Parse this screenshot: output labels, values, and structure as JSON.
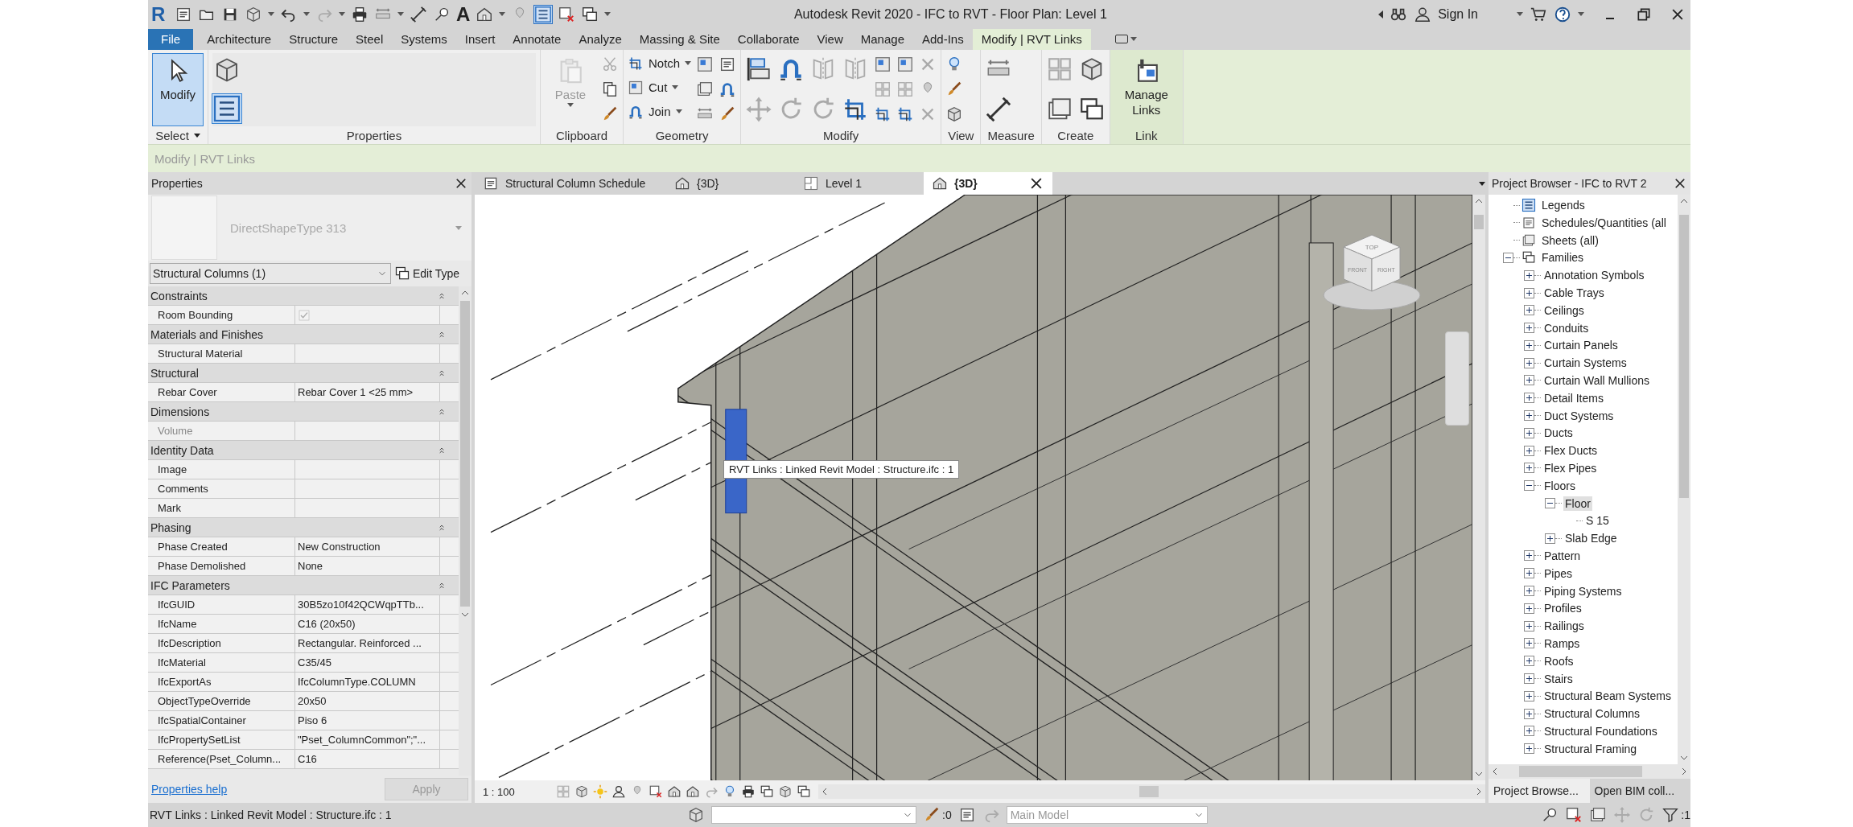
{
  "window": {
    "title": "Autodesk Revit 2020 -  IFC to RVT - Floor Plan: Level 1",
    "app_logo": "R",
    "text_tool": "A"
  },
  "account": {
    "sign_in": "Sign In"
  },
  "ribbon_tabs": [
    {
      "label": "File",
      "kind": "file",
      "selected": false
    },
    {
      "label": "Architecture",
      "kind": "tab",
      "selected": false
    },
    {
      "label": "Structure",
      "kind": "tab",
      "selected": false
    },
    {
      "label": "Steel",
      "kind": "tab",
      "selected": false
    },
    {
      "label": "Systems",
      "kind": "tab",
      "selected": false
    },
    {
      "label": "Insert",
      "kind": "tab",
      "selected": false
    },
    {
      "label": "Annotate",
      "kind": "tab",
      "selected": false
    },
    {
      "label": "Analyze",
      "kind": "tab",
      "selected": false
    },
    {
      "label": "Massing & Site",
      "kind": "tab",
      "selected": false
    },
    {
      "label": "Collaborate",
      "kind": "tab",
      "selected": false
    },
    {
      "label": "View",
      "kind": "tab",
      "selected": false
    },
    {
      "label": "Manage",
      "kind": "tab",
      "selected": false
    },
    {
      "label": "Add-Ins",
      "kind": "tab",
      "selected": false
    },
    {
      "label": "Modify | RVT Links",
      "kind": "tab",
      "selected": true
    }
  ],
  "ribbon_panels": [
    {
      "title": "Select",
      "has_menu": true,
      "contextual": false,
      "tools": [
        {
          "label": "Modify",
          "kind": "large",
          "active": true,
          "disabled": false
        }
      ]
    },
    {
      "title": "Properties",
      "has_menu": false,
      "contextual": false
    },
    {
      "title": "Clipboard",
      "has_menu": false,
      "contextual": false,
      "tools": [
        {
          "label": "Paste",
          "kind": "large",
          "active": false,
          "disabled": true
        }
      ]
    },
    {
      "title": "Geometry",
      "has_menu": false,
      "contextual": false,
      "tools": [
        {
          "label": "Notch",
          "kind": "small",
          "active": false,
          "disabled": false
        },
        {
          "label": "Cut",
          "kind": "small",
          "active": false,
          "disabled": false
        },
        {
          "label": "Join",
          "kind": "small",
          "active": false,
          "disabled": false
        }
      ]
    },
    {
      "title": "Modify",
      "has_menu": false,
      "contextual": false
    },
    {
      "title": "View",
      "has_menu": false,
      "contextual": false
    },
    {
      "title": "Measure",
      "has_menu": false,
      "contextual": false
    },
    {
      "title": "Create",
      "has_menu": false,
      "contextual": false
    },
    {
      "title": "Link",
      "has_menu": false,
      "contextual": true,
      "tools": [
        {
          "label": "Manage Links",
          "kind": "large",
          "active": false,
          "disabled": false
        }
      ]
    }
  ],
  "context_bar": "Modify | RVT Links",
  "properties": {
    "title": "Properties",
    "type_name": "DirectShapeType 313",
    "selector": "Structural Columns (1)",
    "edit_type": "Edit Type",
    "groups": [
      {
        "name": "Constraints",
        "rows": [
          {
            "name": "Room Bounding",
            "kind": "checkbox",
            "checked": true,
            "disabled": false
          }
        ]
      },
      {
        "name": "Materials and Finishes",
        "rows": [
          {
            "name": "Structural Material",
            "kind": "text",
            "disabled": false
          }
        ]
      },
      {
        "name": "Structural",
        "rows": [
          {
            "name": "Rebar Cover",
            "value": "Rebar Cover 1 <25 mm>",
            "kind": "text",
            "disabled": false
          }
        ]
      },
      {
        "name": "Dimensions",
        "rows": [
          {
            "name": "Volume",
            "kind": "text",
            "disabled": true
          }
        ]
      },
      {
        "name": "Identity Data",
        "rows": [
          {
            "name": "Image",
            "kind": "text",
            "disabled": false
          },
          {
            "name": "Comments",
            "kind": "text",
            "disabled": false
          },
          {
            "name": "Mark",
            "kind": "text",
            "disabled": false
          }
        ]
      },
      {
        "name": "Phasing",
        "rows": [
          {
            "name": "Phase Created",
            "value": "New Construction",
            "kind": "text",
            "disabled": false
          },
          {
            "name": "Phase Demolished",
            "value": "None",
            "kind": "text",
            "disabled": false
          }
        ]
      },
      {
        "name": "IFC Parameters",
        "rows": [
          {
            "name": "IfcGUID",
            "value": "30B5zo10f42QCWqpTTb...",
            "kind": "text",
            "disabled": false
          },
          {
            "name": "IfcName",
            "value": "C16 (20x50)",
            "kind": "text",
            "disabled": false
          },
          {
            "name": "IfcDescription",
            "value": "Rectangular. Reinforced ...",
            "kind": "text",
            "disabled": false
          },
          {
            "name": "IfcMaterial",
            "value": "C35/45",
            "kind": "text",
            "disabled": false
          },
          {
            "name": "IfcExportAs",
            "value": "IfcColumnType.COLUMN",
            "kind": "text",
            "disabled": false
          },
          {
            "name": "ObjectTypeOverride",
            "value": "20x50",
            "kind": "text",
            "disabled": false
          },
          {
            "name": "IfcSpatialContainer",
            "value": "Piso 6",
            "kind": "text",
            "disabled": false
          },
          {
            "name": "IfcPropertySetList",
            "value": "\"Pset_ColumnCommon\";\"...",
            "kind": "text",
            "disabled": false
          },
          {
            "name": "Reference(Pset_Column...",
            "value": "C16",
            "kind": "text",
            "disabled": false
          }
        ]
      }
    ],
    "help_link": "Properties help",
    "apply": "Apply"
  },
  "view_tabs": [
    {
      "label": "Structural Column Schedule",
      "kind": "schedule",
      "selected": false
    },
    {
      "label": "{3D}",
      "kind": "threed",
      "selected": false
    },
    {
      "label": "Level 1",
      "kind": "plan",
      "selected": false
    },
    {
      "label": "{3D}",
      "kind": "threed",
      "selected": true
    }
  ],
  "view": {
    "tooltip": "RVT Links : Linked Revit Model : Structure.ifc : 1",
    "view_cube": [
      "TOP",
      "FRONT",
      "RIGHT"
    ],
    "scale": "1 : 100"
  },
  "project_browser": {
    "title": "Project Browser - IFC to RVT 2",
    "tree": [
      {
        "label": "Legends",
        "kind": "legend",
        "selected": false
      },
      {
        "label": "Schedules/Quantities (all",
        "kind": "schedule",
        "selected": false
      },
      {
        "label": "Sheets (all)",
        "kind": "sheet",
        "selected": false
      },
      {
        "label": "Families",
        "kind": "family",
        "selected": false,
        "expanded": true,
        "children": [
          {
            "label": "Annotation Symbols",
            "selected": false,
            "expanded": false
          },
          {
            "label": "Cable Trays",
            "selected": false,
            "expanded": false
          },
          {
            "label": "Ceilings",
            "selected": false,
            "expanded": false
          },
          {
            "label": "Conduits",
            "selected": false,
            "expanded": false
          },
          {
            "label": "Curtain Panels",
            "selected": false,
            "expanded": false
          },
          {
            "label": "Curtain Systems",
            "selected": false,
            "expanded": false
          },
          {
            "label": "Curtain Wall Mullions",
            "selected": false,
            "expanded": false
          },
          {
            "label": "Detail Items",
            "selected": false,
            "expanded": false
          },
          {
            "label": "Duct Systems",
            "selected": false,
            "expanded": false
          },
          {
            "label": "Ducts",
            "selected": false,
            "expanded": false
          },
          {
            "label": "Flex Ducts",
            "selected": false,
            "expanded": false
          },
          {
            "label": "Flex Pipes",
            "selected": false,
            "expanded": false
          },
          {
            "label": "Floors",
            "selected": false,
            "expanded": true,
            "children": [
              {
                "label": "Floor",
                "selected": true,
                "expanded": true,
                "children": [
                  {
                    "label": "S 15",
                    "selected": false
                  }
                ]
              },
              {
                "label": "Slab Edge",
                "selected": false,
                "expanded": false
              }
            ]
          },
          {
            "label": "Pattern",
            "selected": false,
            "expanded": false
          },
          {
            "label": "Pipes",
            "selected": false,
            "expanded": false
          },
          {
            "label": "Piping Systems",
            "selected": false,
            "expanded": false
          },
          {
            "label": "Profiles",
            "selected": false,
            "expanded": false
          },
          {
            "label": "Railings",
            "selected": false,
            "expanded": false
          },
          {
            "label": "Ramps",
            "selected": false,
            "expanded": false
          },
          {
            "label": "Roofs",
            "selected": false,
            "expanded": false
          },
          {
            "label": "Stairs",
            "selected": false,
            "expanded": false
          },
          {
            "label": "Structural Beam Systems",
            "selected": false,
            "expanded": false
          },
          {
            "label": "Structural Columns",
            "selected": false,
            "expanded": false
          },
          {
            "label": "Structural Foundations",
            "selected": false,
            "expanded": false
          },
          {
            "label": "Structural Framing",
            "selected": false,
            "expanded": false
          }
        ]
      }
    ],
    "tabs": [
      {
        "label": "Project Browse...",
        "selected": true
      },
      {
        "label": "Open BIM coll...",
        "selected": false
      }
    ]
  },
  "status_bar": {
    "message": "RVT Links : Linked Revit Model : Structure.ifc : 1",
    "workset_count": ":0",
    "model": "Main Model",
    "filter_count": ":1"
  }
}
